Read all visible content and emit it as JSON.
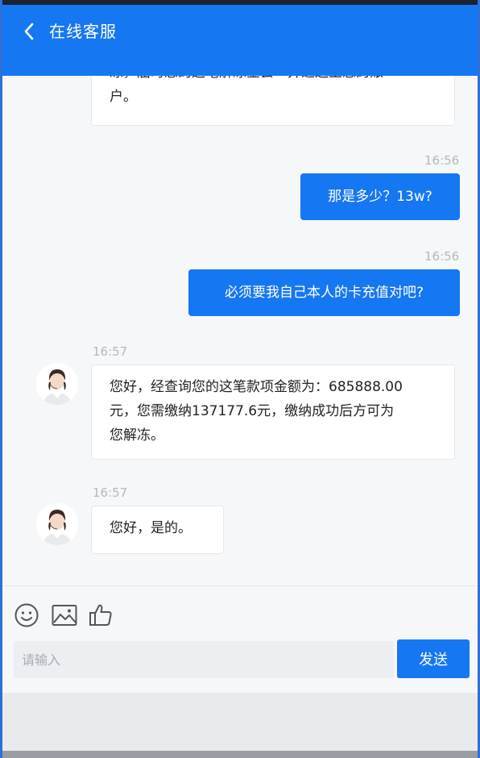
{
  "header": {
    "title": "在线客服",
    "background": "#1677f2"
  },
  "messages": [
    {
      "from": "agent",
      "partial": true,
      "lines": [
        "冻，届时您的这笔解冻金会一并退还至您的账",
        "户。"
      ]
    },
    {
      "from": "me",
      "time": "16:56",
      "text": "那是多少？13w?"
    },
    {
      "from": "me",
      "time": "16:56",
      "text": "必须要我自己本人的卡充值对吧?"
    },
    {
      "from": "agent",
      "time": "16:57",
      "lines": [
        "您好，经查询您的这笔款项金额为：685888.00",
        "元，您需缴纳137177.6元，缴纳成功后方可为",
        "您解冻。"
      ]
    },
    {
      "from": "agent",
      "time": "16:57",
      "lines": [
        "您好，是的。"
      ]
    }
  ],
  "toolbar": {
    "icons": [
      "smiley-icon",
      "image-icon",
      "thumbs-up-icon"
    ]
  },
  "composer": {
    "placeholder": "请输入",
    "send_label": "发送"
  }
}
